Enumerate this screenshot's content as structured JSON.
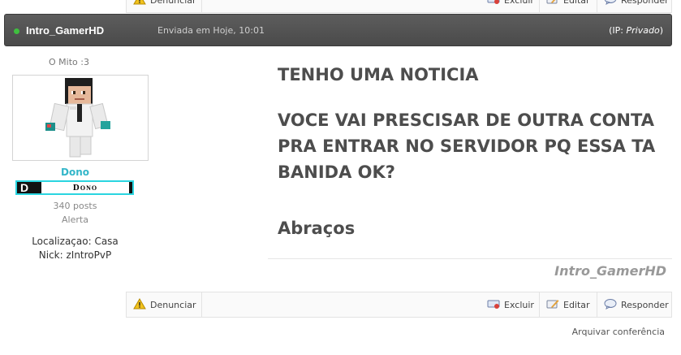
{
  "post_actions": {
    "report_label": "Denunciar",
    "delete_label": "Excluir",
    "edit_label": "Editar",
    "reply_label": "Responder"
  },
  "post_header": {
    "author": "Intro_GamerHD",
    "date": "Enviada em Hoje, 10:01",
    "ip_prefix": "(IP: ",
    "ip_value": "Privado",
    "ip_suffix": ")",
    "online_color": "#3fbf3f"
  },
  "author_info": {
    "title": "O Mito :3",
    "rank": "Dono",
    "badge_letter": "D",
    "badge_text": "Dono",
    "badge_border_color": "#2ad5e0",
    "posts": "340 posts",
    "status": "Alerta",
    "location": "Localizaçao: Casa",
    "nick": "Nick: zIntroPvP"
  },
  "post": {
    "line1": "TENHO UMA NOTICIA",
    "line2": "VOCE VAI PRESCISAR DE OUTRA CONTA PRA ENTRAR NO SERVIDOR PQ ESSA TA BANIDA OK?",
    "line3": "Abraços"
  },
  "signature": "Intro_GamerHD",
  "archive_link": "Arquivar conferência",
  "icons": [
    "warning-icon",
    "delete-icon",
    "edit-icon",
    "reply-icon"
  ]
}
